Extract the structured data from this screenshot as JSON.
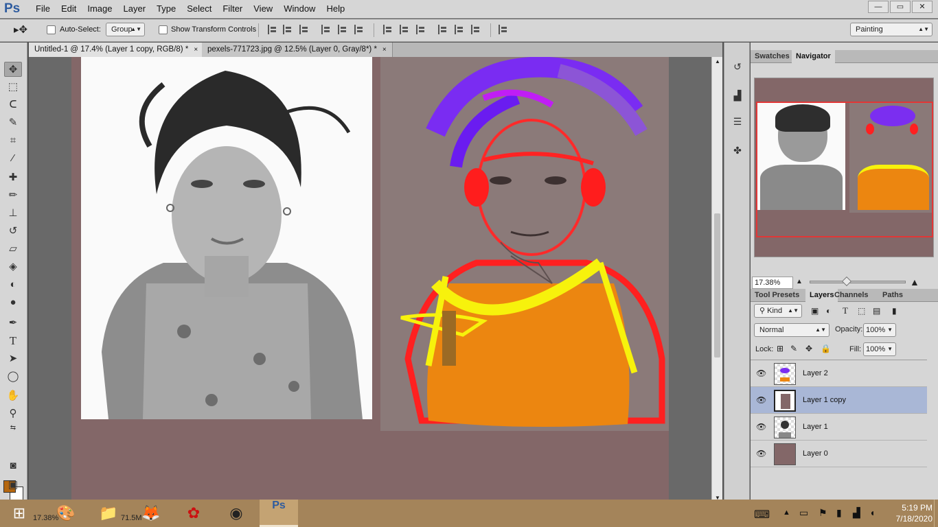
{
  "app": {
    "logo": "Ps"
  },
  "menu": [
    "File",
    "Edit",
    "Image",
    "Layer",
    "Type",
    "Select",
    "Filter",
    "View",
    "Window",
    "Help"
  ],
  "window_buttons": {
    "minimize": "—",
    "restore": "▭",
    "close": "✕"
  },
  "options": {
    "auto_select_label": "Auto-Select:",
    "auto_select_value": "Group",
    "transform_label": "Show Transform Controls",
    "workspace": "Painting"
  },
  "tabs": [
    {
      "label": "Untitled-1 @ 17.4% (Layer 1 copy, RGB/8) *",
      "close": "×"
    },
    {
      "label": "pexels-771723.jpg @ 12.5% (Layer 0, Gray/8*) *",
      "close": "×"
    }
  ],
  "tools": [
    "move-tool",
    "rect-marquee",
    "lasso",
    "quick-select",
    "crop",
    "eyedropper",
    "healing-brush",
    "brush",
    "clone-stamp",
    "history-brush",
    "eraser",
    "paint-bucket",
    "blur",
    "dodge",
    "pen",
    "type",
    "path-select",
    "ellipse",
    "hand",
    "zoom"
  ],
  "colors": {
    "foreground": "#b5670f",
    "background": "#ffffff",
    "canvas": "#836768",
    "selected_layer": "#a9b7d6"
  },
  "panels": {
    "top_tabs": [
      "Swatches",
      "Navigator"
    ],
    "navigator_zoom": "17.38%",
    "layer_tabs": [
      "Tool Presets",
      "Layers",
      "Channels",
      "Paths"
    ],
    "kind_label": "Kind",
    "blend_mode": "Normal",
    "opacity_label": "Opacity:",
    "opacity_value": "100%",
    "lock_label": "Lock:",
    "fill_label": "Fill:",
    "fill_value": "100%",
    "layers": [
      "Layer 2",
      "Layer 1 copy",
      "Layer 1",
      "Layer 0"
    ]
  },
  "status": {
    "zoom": "17.38%",
    "doc": "71.5M"
  },
  "clock": {
    "time": "5:19 PM",
    "date": "7/18/2020"
  }
}
